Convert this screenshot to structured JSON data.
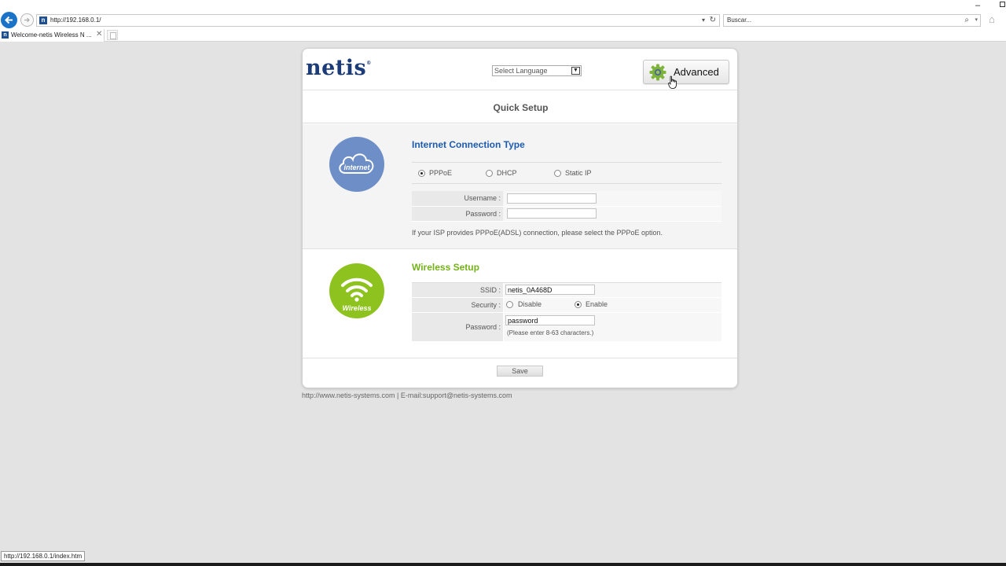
{
  "browser": {
    "url": "http://192.168.0.1/",
    "search_placeholder": "Buscar...",
    "tab_title": "Welcome-netis Wireless N ...",
    "status_url": "http://192.168.0.1/index.htm"
  },
  "header": {
    "logo": "netis",
    "logo_tm": "®",
    "language_select": "Select Language",
    "advanced_label": "Advanced"
  },
  "page_title": "Quick Setup",
  "internet": {
    "icon_label": "internet",
    "heading": "Internet Connection Type",
    "options": [
      "PPPoE",
      "DHCP",
      "Static IP"
    ],
    "selected": "PPPoE",
    "username_label": "Username :",
    "username_value": "",
    "password_label": "Password :",
    "password_value": "",
    "hint": "If your ISP provides PPPoE(ADSL) connection, please select the PPPoE option."
  },
  "wireless": {
    "icon_label": "Wireless",
    "heading": "Wireless Setup",
    "ssid_label": "SSID :",
    "ssid_value": "netis_0A468D",
    "security_label": "Security :",
    "security_options": [
      "Disable",
      "Enable"
    ],
    "security_selected": "Enable",
    "password_label": "Password :",
    "password_value": "password",
    "password_hint": "(Please enter 8-63 characters.)"
  },
  "save_label": "Save",
  "footer": "http://www.netis-systems.com | E-mail:support@netis-systems.com",
  "colors": {
    "brand": "#1b3c78",
    "internet_blue": "#6d8ec7",
    "wireless_green": "#8dc21f",
    "heading_blue": "#1d5bb0",
    "heading_green": "#74b21a"
  }
}
